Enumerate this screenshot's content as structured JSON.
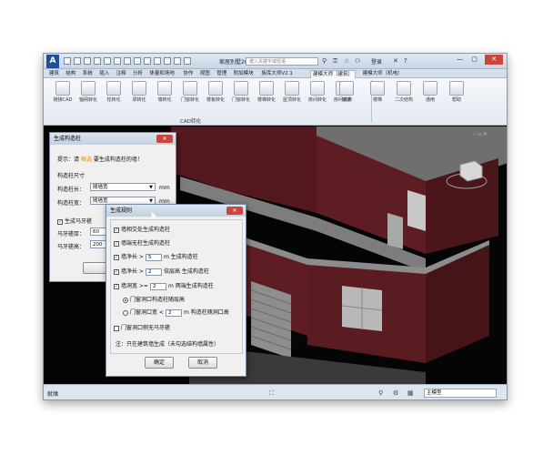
{
  "titlebar": {
    "logo": "A",
    "doc_title": "家居別墅2018.rvt",
    "search_placeholder": "键入关键字或短语",
    "login": "登录",
    "minimize": "—",
    "restore": "▢",
    "close": "✕"
  },
  "tabs": [
    "建筑",
    "结构",
    "系统",
    "插入",
    "注释",
    "分析",
    "体量和场地",
    "协作",
    "视图",
    "管理",
    "附加模块",
    "族库大师V2.1",
    "建模大师（建筑）",
    "建模大师（机电）"
  ],
  "active_tab": "建模大师（建筑）",
  "ribbon": {
    "tools": [
      "链接CAD",
      "轴网转化",
      "柱转化",
      "梁转化",
      "墙转化",
      "门窗转化",
      "楼板转化",
      "门窗转化",
      "楼梯转化",
      "屋顶转化",
      "房间转化",
      "房间装饰",
      "快速",
      "楼梯",
      "二次结构",
      "通用",
      "帮助"
    ],
    "panel_label": "CAD转化"
  },
  "dialog_main": {
    "title": "生成构造柱",
    "hint_prefix": "提示：请",
    "hint_highlight": "框选",
    "hint_suffix": "要生成构造柱的墙！",
    "section_size": "构造柱尺寸",
    "len_label": "构造柱长：",
    "len_value": "随墙宽",
    "width_label": "构造柱宽：",
    "width_value": "随墙宽",
    "unit": "mm",
    "gen_horsetooth_label": "生成马牙槎",
    "tooth_thickness_label": "马牙槎厚：",
    "tooth_thickness_value": "60",
    "tooth_height_label": "马牙槎高：",
    "tooth_height_value": "200"
  },
  "dialog_rules": {
    "title": "生成规则",
    "opt1": "墙相交处生成构造柱",
    "opt2": "墙端无柱生成构造柱",
    "opt3_prefix": "墙净长 >",
    "opt3_value": "5",
    "opt3_suffix": "m 生成构造柱",
    "opt4_prefix": "墙净长 >",
    "opt4_value": "2",
    "opt4_suffix": "倍层高 生成构造柱",
    "opt5_prefix": "墙洞宽 >=",
    "opt5_value": "2",
    "opt5_suffix": "m 两端生成构造柱",
    "radio1": "门窗洞口构造柱随层高",
    "radio2_prefix": "门窗洞口宽 <",
    "radio2_value": "2",
    "radio2_suffix": "m 构造柱随洞口高",
    "opt6": "门窗洞口侧无马牙槎",
    "note": "注：只在建筑墙生成（未勾选结构墙属性）",
    "ok": "确定",
    "cancel": "取消"
  },
  "status": {
    "text": "就绪",
    "model_select": "主模型"
  },
  "colors": {
    "brick": "#5e1d22",
    "brick_dark": "#3d1216",
    "slab_top": "#7b7b7b",
    "wall_trim": "#8c8c8c",
    "highlight": "#e58b00"
  }
}
